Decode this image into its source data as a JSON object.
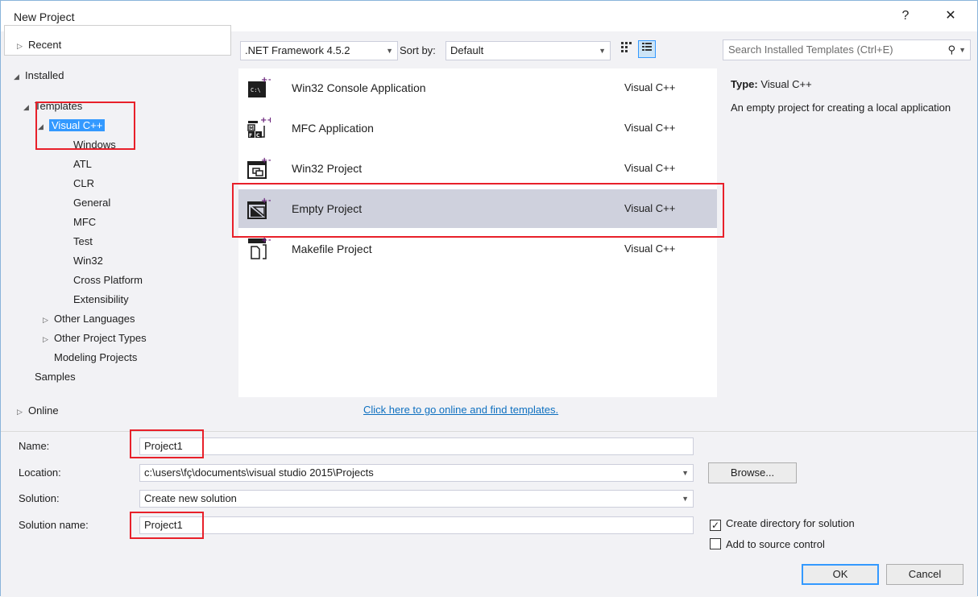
{
  "window": {
    "title": "New Project",
    "help_label": "?",
    "close_label": "✕"
  },
  "tree": {
    "recent": "Recent",
    "installed": "Installed",
    "templates": "Templates",
    "visual_cpp": "Visual C++",
    "children": [
      "Windows",
      "ATL",
      "CLR",
      "General",
      "MFC",
      "Test",
      "Win32",
      "Cross Platform",
      "Extensibility"
    ],
    "other_languages": "Other Languages",
    "other_project_types": "Other Project Types",
    "modeling_projects": "Modeling Projects",
    "samples": "Samples",
    "online": "Online"
  },
  "toolbar": {
    "framework": ".NET Framework 4.5.2",
    "sort_label": "Sort by:",
    "sort_value": "Default"
  },
  "templates": [
    {
      "name": "Win32 Console Application",
      "lang": "Visual C++",
      "icon": "console-app-icon"
    },
    {
      "name": "MFC Application",
      "lang": "Visual C++",
      "icon": "mfc-app-icon"
    },
    {
      "name": "Win32 Project",
      "lang": "Visual C++",
      "icon": "win32-project-icon"
    },
    {
      "name": "Empty Project",
      "lang": "Visual C++",
      "icon": "empty-project-icon",
      "selected": true
    },
    {
      "name": "Makefile Project",
      "lang": "Visual C++",
      "icon": "makefile-project-icon"
    }
  ],
  "online_link": "Click here to go online and find templates.",
  "search": {
    "placeholder": "Search Installed Templates (Ctrl+E)"
  },
  "description": {
    "type_label": "Type:",
    "type_value": "Visual C++",
    "text": "An empty project for creating a local application"
  },
  "form": {
    "name_label": "Name:",
    "name_value": "Project1",
    "location_label": "Location:",
    "location_value": "c:\\users\\fç\\documents\\visual studio 2015\\Projects",
    "solution_label": "Solution:",
    "solution_value": "Create new solution",
    "solution_name_label": "Solution name:",
    "solution_name_value": "Project1",
    "browse_label": "Browse...",
    "create_dir_label": "Create directory for solution",
    "create_dir_checked": true,
    "source_control_label": "Add to source control",
    "source_control_checked": false,
    "ok_label": "OK",
    "cancel_label": "Cancel"
  },
  "colors": {
    "accent": "#3399ff",
    "annotation": "#e8202a",
    "link": "#0e70c0"
  }
}
